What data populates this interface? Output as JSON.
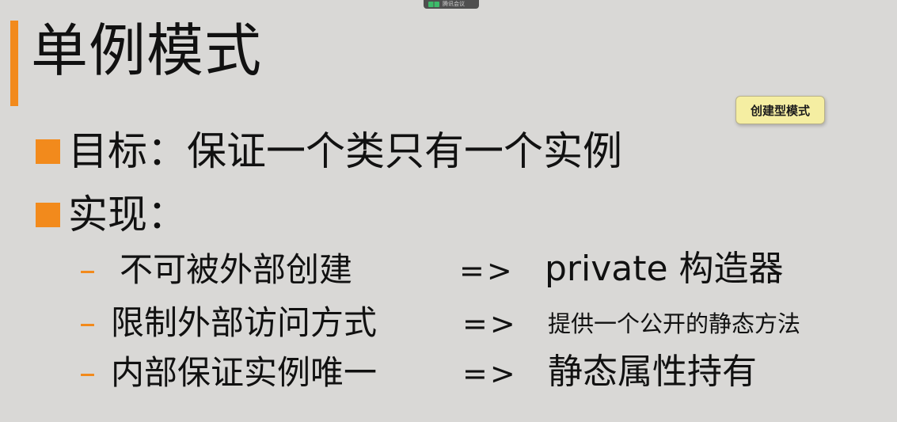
{
  "meeting_bar": {
    "label": "腾讯会议",
    "icon": "meeting-icon"
  },
  "slide": {
    "title": "单例模式",
    "tag": "创建型模式",
    "bullets": [
      {
        "text": "目标：保证一个类只有一个实例"
      },
      {
        "text": "实现："
      }
    ],
    "sub_items": [
      {
        "dash": "–",
        "left": "不可被外部创建",
        "arrow": "=>",
        "right": "private 构造器"
      },
      {
        "dash": "–",
        "left": "限制外部访问方式",
        "arrow": "=>",
        "right": "提供一个公开的静态方法"
      },
      {
        "dash": "–",
        "left": "内部保证实例唯一",
        "arrow": "=>",
        "right": "静态属性持有"
      }
    ]
  },
  "colors": {
    "background": "#d9d8d6",
    "accent": "#f28a1c",
    "tag_background": "#f5eea2",
    "text": "#111111"
  }
}
